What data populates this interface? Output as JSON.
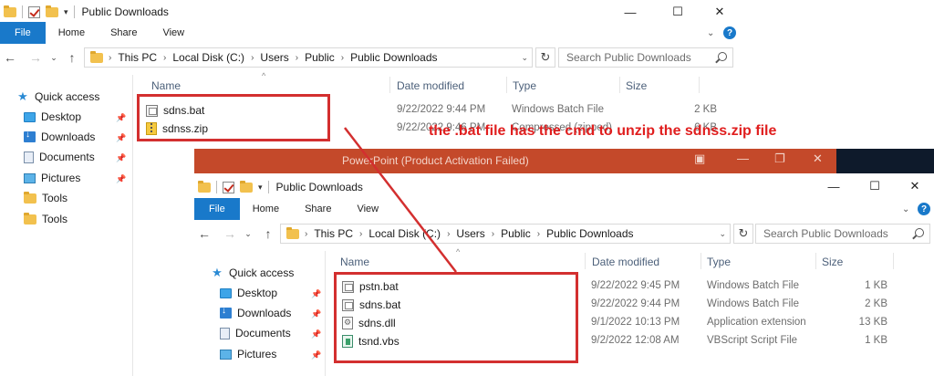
{
  "back_window": {
    "title": "Public Downloads",
    "ribbon": {
      "file": "File",
      "home": "Home",
      "share": "Share",
      "view": "View"
    },
    "breadcrumb": [
      "This PC",
      "Local Disk (C:)",
      "Users",
      "Public",
      "Public Downloads"
    ],
    "search_placeholder": "Search Public Downloads",
    "sidebar": {
      "quick_access": "Quick access",
      "items": [
        "Desktop",
        "Downloads",
        "Documents",
        "Pictures",
        "Tools",
        "Tools"
      ]
    },
    "columns": {
      "name": "Name",
      "date": "Date modified",
      "type": "Type",
      "size": "Size"
    },
    "files": [
      {
        "name": "sdns.bat",
        "date": "9/22/2022 9:44 PM",
        "type": "Windows Batch File",
        "size": "2 KB"
      },
      {
        "name": "sdnss.zip",
        "date": "9/22/2022 9:46 PM",
        "type": "Compressed (zipped)",
        "size": "6 KB"
      }
    ]
  },
  "powerpoint_bar": {
    "title": "PowerPoint (Product Activation Failed)"
  },
  "front_window": {
    "title": "Public Downloads",
    "ribbon": {
      "file": "File",
      "home": "Home",
      "share": "Share",
      "view": "View"
    },
    "breadcrumb": [
      "This PC",
      "Local Disk (C:)",
      "Users",
      "Public",
      "Public Downloads"
    ],
    "search_placeholder": "Search Public Downloads",
    "sidebar": {
      "quick_access": "Quick access",
      "items": [
        "Desktop",
        "Downloads",
        "Documents",
        "Pictures"
      ]
    },
    "columns": {
      "name": "Name",
      "date": "Date modified",
      "type": "Type",
      "size": "Size"
    },
    "files": [
      {
        "name": "pstn.bat",
        "date": "9/22/2022 9:45 PM",
        "type": "Windows Batch File",
        "size": "1 KB"
      },
      {
        "name": "sdns.bat",
        "date": "9/22/2022 9:44 PM",
        "type": "Windows Batch File",
        "size": "2 KB"
      },
      {
        "name": "sdns.dll",
        "date": "9/1/2022 10:13 PM",
        "type": "Application extension",
        "size": "13 KB"
      },
      {
        "name": "tsnd.vbs",
        "date": "9/2/2022 12:08 AM",
        "type": "VBScript Script File",
        "size": "1 KB"
      }
    ]
  },
  "annotation": {
    "text": "the .bat file has the cmd to unzip the sdnss.zip file",
    "color": "#e01e1e"
  },
  "colors": {
    "file_tab": "#1979ca",
    "highlight": "#d32f2f",
    "powerpoint": "#c4492a"
  }
}
